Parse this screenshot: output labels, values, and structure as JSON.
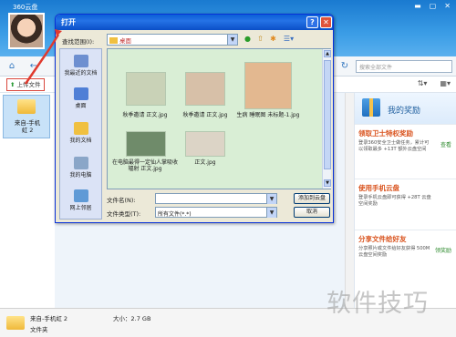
{
  "app": {
    "title": "360云盘",
    "search_placeholder": "搜索全部文件",
    "upload_label": "上传文件",
    "left_folder_label": "来自-手机\n虹 2",
    "window_controls": [
      "minimize-icon",
      "maximize-icon",
      "close-icon"
    ]
  },
  "reward": {
    "title": "我的奖励",
    "sections": [
      {
        "title": "领取卫士特权奖励",
        "desc": "登录360安全卫士做任务，累计可以领取最多 +13T 额外云盘空间",
        "action": "查看"
      },
      {
        "title": "使用手机云盘",
        "desc": "登录手机云盘即可获得 +28T 云盘空间奖励",
        "action": ""
      },
      {
        "title": "分享文件给好友",
        "desc": "分享照片或文件给好友获得 500M 云盘空间奖励",
        "action": "领奖励"
      }
    ]
  },
  "details": {
    "name": "来自-手机虹 2",
    "type": "文件夹",
    "size_label": "大小：2.7 GB"
  },
  "watermark": "软件技巧",
  "dialog": {
    "title": "打开",
    "help_label": "?",
    "close_label": "✕",
    "look_in_label": "查找范围(I):",
    "look_in_value": "桌面",
    "places": [
      {
        "label": "我最近的文档",
        "icon": "recent-docs-icon"
      },
      {
        "label": "桌面",
        "icon": "desktop-icon"
      },
      {
        "label": "我的文档",
        "icon": "my-documents-icon"
      },
      {
        "label": "我的电脑",
        "icon": "my-computer-icon"
      },
      {
        "label": "网上邻居",
        "icon": "network-icon"
      }
    ],
    "files": [
      {
        "name": "秋季邀请 正文.jpg",
        "color": "#c9d2b7"
      },
      {
        "name": "秋季邀请 正文.jpg",
        "color": "#d7c0a8"
      },
      {
        "name": "生病 睡眠图 未标题-1.jpg",
        "color": "#e3b890"
      },
      {
        "name": "在电脑最得一定仙人掌吸收辐射 正文.jpg",
        "color": "#6f8b6a"
      },
      {
        "name": "正文.jpg",
        "color": "#dcd4c6"
      }
    ],
    "filename_label": "文件名(N):",
    "filetype_label": "文件类型(T):",
    "filetype_value": "所有文件(*.*)",
    "add_button": "添加到云盘",
    "cancel_button": "取消"
  }
}
